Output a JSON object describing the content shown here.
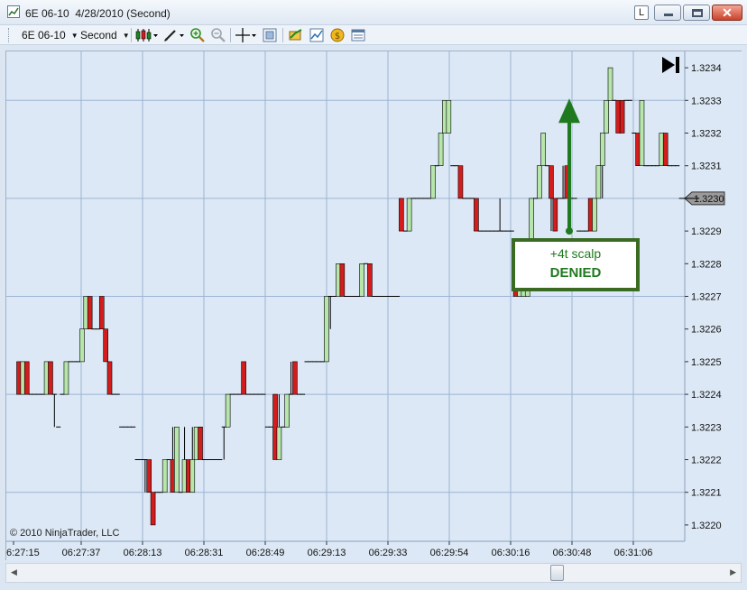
{
  "window": {
    "title": "6E 06-10  4/28/2010 (Second)",
    "link_label": "L",
    "close_glyph": "✕"
  },
  "toolbar": {
    "instrument": "6E 06-10",
    "period": "Second",
    "icons": [
      "bar-style-icon",
      "draw-tool-icon",
      "zoom-in-icon",
      "zoom-out-icon",
      "crosshair-icon",
      "data-box-icon",
      "strategy-icon",
      "indicators-icon",
      "market-analyzer-icon",
      "properties-icon"
    ]
  },
  "chart_data": {
    "type": "candlestick",
    "instrument": "6E 06-10",
    "interval": "Second",
    "tick_size": 0.0001,
    "ylim": [
      1.32195,
      1.32345
    ],
    "y_ticks": [
      1.322,
      1.3221,
      1.3222,
      1.3223,
      1.3224,
      1.3225,
      1.3226,
      1.3227,
      1.3228,
      1.3229,
      1.323,
      1.3231,
      1.3232,
      1.3233,
      1.3234
    ],
    "x_ticks": [
      "6:27:15",
      "06:27:37",
      "06:28:13",
      "06:28:31",
      "06:28:49",
      "06:29:13",
      "06:29:33",
      "06:29:54",
      "06:30:16",
      "06:30:48",
      "06:31:06"
    ],
    "last_price": "1.3230",
    "watermark": "© 2010 NinjaTrader, LLC",
    "colors": {
      "up": "#b6e6aa",
      "down": "#d51c1c",
      "wick": "#000000",
      "grid": "#9db4d4",
      "bg": "#dce8f5",
      "annotation": "#1f7a1f",
      "annotation_border": "#3b6b23"
    },
    "bars": [
      [
        1.3225,
        1.3225,
        1.3224,
        1.3224
      ],
      [
        1.3224,
        1.3225,
        1.3224,
        1.3225
      ],
      [
        1.3225,
        1.3225,
        1.3224,
        1.3224
      ],
      [
        1.3224,
        1.3224,
        1.3224,
        1.3224
      ],
      [
        1.3224,
        1.3224,
        1.3224,
        1.3224
      ],
      [
        1.3224,
        1.3224,
        1.3224,
        1.3224
      ],
      [
        1.3224,
        1.3224,
        1.3224,
        1.3224
      ],
      [
        1.3224,
        1.3225,
        1.3224,
        1.3225
      ],
      [
        1.3225,
        1.3225,
        1.3224,
        1.3224
      ],
      [
        1.3224,
        1.3224,
        1.3223,
        1.3224
      ],
      [
        1.3223,
        1.3223,
        1.3223,
        1.3223
      ],
      [
        1.3224,
        1.3224,
        1.3224,
        1.3224
      ],
      [
        1.3224,
        1.3225,
        1.3224,
        1.3225
      ],
      [
        1.3225,
        1.3225,
        1.3225,
        1.3225
      ],
      [
        1.3225,
        1.3225,
        1.3225,
        1.3225
      ],
      [
        1.3225,
        1.3225,
        1.3225,
        1.3225
      ],
      [
        1.3225,
        1.3226,
        1.3225,
        1.3226
      ],
      [
        1.3226,
        1.3227,
        1.3226,
        1.3227
      ],
      [
        1.3227,
        1.3227,
        1.3226,
        1.3226
      ],
      [
        1.3226,
        1.3226,
        1.3226,
        1.3226
      ],
      [
        1.3226,
        1.3226,
        1.3226,
        1.3226
      ],
      [
        1.3227,
        1.3227,
        1.3226,
        1.3226
      ],
      [
        1.3226,
        1.3226,
        1.3225,
        1.3225
      ],
      [
        1.3225,
        1.3225,
        1.3224,
        1.3224
      ],
      [
        1.3224,
        1.3224,
        1.3224,
        1.3224
      ],
      [
        1.3224,
        1.3224,
        1.3224,
        1.3224
      ],
      [
        1.3223,
        1.3223,
        1.3223,
        1.3223
      ],
      [
        1.3223,
        1.3223,
        1.3223,
        1.3223
      ],
      [
        1.3223,
        1.3223,
        1.3223,
        1.3223
      ],
      [
        1.3223,
        1.3223,
        1.3223,
        1.3223
      ],
      [
        1.3222,
        1.3222,
        1.3222,
        1.3222
      ],
      [
        1.3222,
        1.3222,
        1.3222,
        1.3222
      ],
      [
        1.3222,
        1.3222,
        1.3221,
        1.3222
      ],
      [
        1.3222,
        1.3222,
        1.3221,
        1.3221
      ],
      [
        1.3221,
        1.3221,
        1.322,
        1.322
      ],
      [
        1.3221,
        1.3221,
        1.3221,
        1.3221
      ],
      [
        1.3221,
        1.3221,
        1.3221,
        1.3221
      ],
      [
        1.3221,
        1.3222,
        1.3221,
        1.3222
      ],
      [
        1.3222,
        1.3222,
        1.3222,
        1.3222
      ],
      [
        1.3222,
        1.3223,
        1.3221,
        1.3221
      ],
      [
        1.3221,
        1.3223,
        1.3221,
        1.3223
      ],
      [
        1.3221,
        1.3221,
        1.3221,
        1.3221
      ],
      [
        1.3221,
        1.3223,
        1.3221,
        1.3222
      ],
      [
        1.3222,
        1.3222,
        1.3221,
        1.3221
      ],
      [
        1.3221,
        1.3223,
        1.3221,
        1.3222
      ],
      [
        1.3222,
        1.3223,
        1.3222,
        1.3223
      ],
      [
        1.3223,
        1.3223,
        1.3222,
        1.3222
      ],
      [
        1.3222,
        1.3222,
        1.3222,
        1.3222
      ],
      [
        1.3222,
        1.3222,
        1.3222,
        1.3222
      ],
      [
        1.3222,
        1.3222,
        1.3222,
        1.3222
      ],
      [
        1.3222,
        1.3222,
        1.3222,
        1.3222
      ],
      [
        1.3222,
        1.3222,
        1.3222,
        1.3222
      ],
      [
        1.3223,
        1.3223,
        1.3222,
        1.3223
      ],
      [
        1.3223,
        1.3224,
        1.3223,
        1.3224
      ],
      [
        1.3224,
        1.3224,
        1.3224,
        1.3224
      ],
      [
        1.3224,
        1.3224,
        1.3224,
        1.3224
      ],
      [
        1.3224,
        1.3224,
        1.3224,
        1.3224
      ],
      [
        1.3225,
        1.3225,
        1.3224,
        1.3224
      ],
      [
        1.3224,
        1.3224,
        1.3224,
        1.3224
      ],
      [
        1.3224,
        1.3224,
        1.3224,
        1.3224
      ],
      [
        1.3224,
        1.3224,
        1.3224,
        1.3224
      ],
      [
        1.3224,
        1.3224,
        1.3224,
        1.3224
      ],
      [
        1.3224,
        1.3224,
        1.3224,
        1.3224
      ],
      [
        1.3223,
        1.3223,
        1.3223,
        1.3223
      ],
      [
        1.3223,
        1.3223,
        1.3223,
        1.3223
      ],
      [
        1.3224,
        1.3224,
        1.3222,
        1.3222
      ],
      [
        1.3222,
        1.3224,
        1.3222,
        1.3223
      ],
      [
        1.3223,
        1.3223,
        1.3223,
        1.3223
      ],
      [
        1.3223,
        1.3224,
        1.3223,
        1.3224
      ],
      [
        1.3224,
        1.3225,
        1.3224,
        1.3224
      ],
      [
        1.3225,
        1.3225,
        1.3224,
        1.3224
      ],
      [
        1.3224,
        1.3224,
        1.3224,
        1.3224
      ],
      [
        1.3224,
        1.3224,
        1.3224,
        1.3224
      ],
      [
        1.3225,
        1.3225,
        1.3225,
        1.3225
      ],
      [
        1.3225,
        1.3225,
        1.3225,
        1.3225
      ],
      [
        1.3225,
        1.3225,
        1.3225,
        1.3225
      ],
      [
        1.3225,
        1.3225,
        1.3225,
        1.3225
      ],
      [
        1.3225,
        1.3225,
        1.3225,
        1.3225
      ],
      [
        1.3225,
        1.3227,
        1.3225,
        1.3227
      ],
      [
        1.3227,
        1.3227,
        1.3226,
        1.3227
      ],
      [
        1.3227,
        1.3227,
        1.3227,
        1.3227
      ],
      [
        1.3227,
        1.3228,
        1.3227,
        1.3228
      ],
      [
        1.3228,
        1.3228,
        1.3227,
        1.3227
      ],
      [
        1.3227,
        1.3227,
        1.3227,
        1.3227
      ],
      [
        1.3227,
        1.3227,
        1.3227,
        1.3227
      ],
      [
        1.3227,
        1.3227,
        1.3227,
        1.3227
      ],
      [
        1.3227,
        1.3227,
        1.3227,
        1.3227
      ],
      [
        1.3227,
        1.3228,
        1.3227,
        1.3228
      ],
      [
        1.3228,
        1.3228,
        1.3228,
        1.3228
      ],
      [
        1.3228,
        1.3228,
        1.3227,
        1.3227
      ],
      [
        1.3227,
        1.3227,
        1.3227,
        1.3227
      ],
      [
        1.3227,
        1.3227,
        1.3227,
        1.3227
      ],
      [
        1.3227,
        1.3227,
        1.3227,
        1.3227
      ],
      [
        1.3227,
        1.3227,
        1.3227,
        1.3227
      ],
      [
        1.3227,
        1.3227,
        1.3227,
        1.3227
      ],
      [
        1.3227,
        1.3227,
        1.3227,
        1.3227
      ],
      [
        1.3227,
        1.3227,
        1.3227,
        1.3227
      ],
      [
        1.323,
        1.323,
        1.3229,
        1.3229
      ],
      [
        1.3229,
        1.3229,
        1.3229,
        1.3229
      ],
      [
        1.3229,
        1.323,
        1.3229,
        1.323
      ],
      [
        1.323,
        1.323,
        1.323,
        1.323
      ],
      [
        1.323,
        1.323,
        1.323,
        1.323
      ],
      [
        1.323,
        1.323,
        1.323,
        1.323
      ],
      [
        1.323,
        1.323,
        1.323,
        1.323
      ],
      [
        1.323,
        1.323,
        1.323,
        1.323
      ],
      [
        1.323,
        1.3231,
        1.323,
        1.3231
      ],
      [
        1.3231,
        1.3231,
        1.3231,
        1.3231
      ],
      [
        1.3231,
        1.3232,
        1.3231,
        1.3232
      ],
      [
        1.3232,
        1.3233,
        1.3232,
        1.3233
      ],
      [
        1.3232,
        1.3233,
        1.3232,
        1.3233
      ],
      [
        1.3231,
        1.3231,
        1.3231,
        1.3231
      ],
      [
        1.3231,
        1.3231,
        1.3231,
        1.3231
      ],
      [
        1.3231,
        1.3231,
        1.323,
        1.323
      ],
      [
        1.323,
        1.323,
        1.323,
        1.323
      ],
      [
        1.323,
        1.323,
        1.323,
        1.323
      ],
      [
        1.323,
        1.323,
        1.323,
        1.323
      ],
      [
        1.323,
        1.323,
        1.3229,
        1.3229
      ],
      [
        1.3229,
        1.3229,
        1.3229,
        1.3229
      ],
      [
        1.3229,
        1.3229,
        1.3229,
        1.3229
      ],
      [
        1.3229,
        1.3229,
        1.3229,
        1.3229
      ],
      [
        1.3229,
        1.3229,
        1.3229,
        1.3229
      ],
      [
        1.3229,
        1.3229,
        1.3229,
        1.3229
      ],
      [
        1.3229,
        1.323,
        1.3229,
        1.3229
      ],
      [
        1.3229,
        1.3229,
        1.3229,
        1.3229
      ],
      [
        1.3229,
        1.3229,
        1.3229,
        1.3229
      ],
      [
        1.3229,
        1.3229,
        1.3229,
        1.3229
      ],
      [
        1.3228,
        1.3228,
        1.3227,
        1.3227
      ],
      [
        1.3227,
        1.3228,
        1.3227,
        1.3228
      ],
      [
        1.3227,
        1.3228,
        1.3227,
        1.3228
      ],
      [
        1.3227,
        1.3228,
        1.3227,
        1.3228
      ],
      [
        1.3228,
        1.323,
        1.3228,
        1.323
      ],
      [
        1.323,
        1.323,
        1.323,
        1.323
      ],
      [
        1.323,
        1.3231,
        1.323,
        1.3231
      ],
      [
        1.3231,
        1.3232,
        1.3231,
        1.3232
      ],
      [
        1.3231,
        1.3231,
        1.3231,
        1.3231
      ],
      [
        1.3231,
        1.3231,
        1.3229,
        1.323
      ],
      [
        1.323,
        1.323,
        1.3229,
        1.3229
      ],
      [
        1.323,
        1.323,
        1.323,
        1.323
      ],
      [
        1.323,
        1.3231,
        1.323,
        1.323
      ],
      [
        1.3231,
        1.3231,
        1.323,
        1.323
      ],
      [
        1.323,
        1.323,
        1.323,
        1.323
      ],
      [
        1.323,
        1.323,
        1.323,
        1.323
      ],
      [
        1.3229,
        1.3229,
        1.3229,
        1.3229
      ],
      [
        1.3229,
        1.3229,
        1.3229,
        1.3229
      ],
      [
        1.3229,
        1.3229,
        1.3229,
        1.3229
      ],
      [
        1.323,
        1.323,
        1.3229,
        1.3229
      ],
      [
        1.3229,
        1.323,
        1.3229,
        1.323
      ],
      [
        1.323,
        1.3231,
        1.323,
        1.3231
      ],
      [
        1.3231,
        1.3232,
        1.323,
        1.3232
      ],
      [
        1.3232,
        1.3233,
        1.3232,
        1.3233
      ],
      [
        1.3233,
        1.3234,
        1.3233,
        1.3234
      ],
      [
        1.3233,
        1.3233,
        1.3233,
        1.3233
      ],
      [
        1.3233,
        1.3233,
        1.3232,
        1.3232
      ],
      [
        1.3233,
        1.3233,
        1.3232,
        1.3232
      ],
      [
        1.3233,
        1.3233,
        1.3233,
        1.3233
      ],
      [
        1.3233,
        1.3233,
        1.3233,
        1.3233
      ],
      [
        1.3232,
        1.3232,
        1.3232,
        1.3232
      ],
      [
        1.3232,
        1.3232,
        1.3231,
        1.3231
      ],
      [
        1.3231,
        1.3233,
        1.3231,
        1.3233
      ],
      [
        1.3231,
        1.3231,
        1.3231,
        1.3231
      ],
      [
        1.3231,
        1.3231,
        1.3231,
        1.3231
      ],
      [
        1.3231,
        1.3231,
        1.3231,
        1.3231
      ],
      [
        1.3231,
        1.3231,
        1.3231,
        1.3231
      ],
      [
        1.3231,
        1.3232,
        1.3231,
        1.3232
      ],
      [
        1.3232,
        1.3232,
        1.3231,
        1.3231
      ],
      [
        1.3231,
        1.3231,
        1.3231,
        1.3231
      ],
      [
        1.3231,
        1.3231,
        1.3231,
        1.3231
      ],
      [
        1.3231,
        1.3231,
        1.3231,
        1.3231
      ],
      [
        1.323,
        1.323,
        1.323,
        1.323
      ],
      [
        1.323,
        1.323,
        1.323,
        1.323
      ],
      [
        1.323,
        1.323,
        1.323,
        1.323
      ],
      [
        1.323,
        1.323,
        1.323,
        1.323
      ],
      [
        1.323,
        1.323,
        1.323,
        1.323
      ]
    ],
    "annotation": {
      "line1": "+4t scalp",
      "line2": "DENIED",
      "from_price": 1.3229,
      "to_price": 1.3233
    }
  }
}
